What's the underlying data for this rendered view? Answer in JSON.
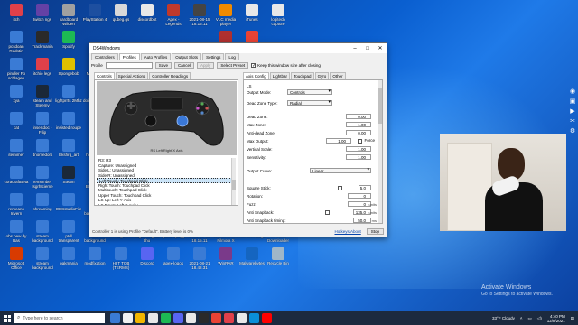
{
  "desktop": {
    "icons": [
      {
        "label": "itch",
        "color": "#e0404a",
        "col": 0,
        "row": 0
      },
      {
        "label": "twitch ngs",
        "color": "#6441a5",
        "col": 1,
        "row": 0
      },
      {
        "label": "cardboard Wilden",
        "color": "#a0a0a0",
        "col": 2,
        "row": 0
      },
      {
        "label": "PlayStation 4",
        "color": "#1d4fa0",
        "col": 3,
        "row": 0
      },
      {
        "label": "qubeg.gs",
        "color": "#d8d8d8",
        "col": 4,
        "row": 0
      },
      {
        "label": "discordbot",
        "color": "#e8e8e8",
        "col": 5,
        "row": 0
      },
      {
        "label": "Apex - Legends",
        "color": "#c0392b",
        "col": 6,
        "row": 0
      },
      {
        "label": "2021-08-15 18.15.11",
        "color": "#444",
        "col": 7,
        "row": 0
      },
      {
        "label": "VLC media player",
        "color": "#f08a00",
        "col": 8,
        "row": 0
      },
      {
        "label": "iTunes",
        "color": "#e8e8e8",
        "col": 9,
        "row": 0
      },
      {
        "label": "logitech capture",
        "color": "#e8e8e8",
        "col": 10,
        "row": 0
      },
      {
        "label": "pcsdoan Redstin",
        "color": "#3a7bd5",
        "col": 0,
        "row": 1
      },
      {
        "label": "Trackmania",
        "color": "#2a2a2a",
        "col": 1,
        "row": 1
      },
      {
        "label": "Spotify",
        "color": "#1db954",
        "col": 2,
        "row": 1
      },
      {
        "label": "Ghostwire",
        "color": "#b03030",
        "col": 8,
        "row": 1
      },
      {
        "label": "Google",
        "color": "#ea4335",
        "col": 9,
        "row": 1
      },
      {
        "label": "pindler Fo schlagen",
        "color": "#3a7bd5",
        "col": 0,
        "row": 2
      },
      {
        "label": "itchio legs",
        "color": "#e0404a",
        "col": 1,
        "row": 2
      },
      {
        "label": "Spongebob",
        "color": "#e0c000",
        "col": 2,
        "row": 2
      },
      {
        "label": "Minecraft",
        "color": "#5a8a2a",
        "col": 3,
        "row": 2
      },
      {
        "label": "xya",
        "color": "#3a7bd5",
        "col": 0,
        "row": 3
      },
      {
        "label": "steam and Steemy",
        "color": "#1b2838",
        "col": 1,
        "row": 3
      },
      {
        "label": "lightprrts 2Mhz",
        "color": "#3a7bd5",
        "col": 2,
        "row": 3
      },
      {
        "label": "doi vicity te 2",
        "color": "#3a7bd5",
        "col": 3,
        "row": 3
      },
      {
        "label": "cat",
        "color": "#3a7bd5",
        "col": 0,
        "row": 4
      },
      {
        "label": "insertdoc - Filip",
        "color": "#3a7bd5",
        "col": 1,
        "row": 4
      },
      {
        "label": "insisted roupe",
        "color": "#3a7bd5",
        "col": 2,
        "row": 4
      },
      {
        "label": "mega",
        "color": "#3a7bd5",
        "col": 3,
        "row": 4
      },
      {
        "label": "itemimer",
        "color": "#3a7bd5",
        "col": 0,
        "row": 5
      },
      {
        "label": "dnomedors",
        "color": "#3a7bd5",
        "col": 1,
        "row": 5
      },
      {
        "label": "Ekshrg_art",
        "color": "#3a7bd5",
        "col": 2,
        "row": 5
      },
      {
        "label": "hime Orin",
        "color": "#3a7bd5",
        "col": 3,
        "row": 5
      },
      {
        "label": "coracraftBeta",
        "color": "#3a7bd5",
        "col": 0,
        "row": 6
      },
      {
        "label": "remember Isgrhtcieme",
        "color": "#3a7bd5",
        "col": 1,
        "row": 6
      },
      {
        "label": "Steam",
        "color": "#1b2838",
        "col": 2,
        "row": 6
      },
      {
        "label": "NVIDIA Broadcast",
        "color": "#76b900",
        "col": 3,
        "row": 6
      },
      {
        "label": "remeans Invern",
        "color": "#3a7bd5",
        "col": 0,
        "row": 7
      },
      {
        "label": "shreaming",
        "color": "#3a7bd5",
        "col": 1,
        "row": 7
      },
      {
        "label": "OBSstudioFile",
        "color": "#3a7bd5",
        "col": 2,
        "row": 7
      },
      {
        "label": "new background",
        "color": "#3a7bd5",
        "col": 3,
        "row": 7
      },
      {
        "label": "new background",
        "color": "#3a7bd5",
        "col": 6,
        "row": 7
      },
      {
        "label": "new background",
        "color": "#3a7bd5",
        "col": 7,
        "row": 7
      },
      {
        "label": "new background",
        "color": "#3a7bd5",
        "col": 8,
        "row": 7
      },
      {
        "label": "obs new dy Bas",
        "color": "#3a7bd5",
        "col": 0,
        "row": 8
      },
      {
        "label": "stream background",
        "color": "#3a7bd5",
        "col": 1,
        "row": 8
      },
      {
        "label": "pIdl transparent",
        "color": "#3a7bd5",
        "col": 2,
        "row": 8
      },
      {
        "label": "new background",
        "color": "#3a7bd5",
        "col": 3,
        "row": 8
      },
      {
        "label": "logo",
        "color": "#3a7bd5",
        "col": 4,
        "row": 8
      },
      {
        "label": "ntgdix svg as thu",
        "color": "#3a7bd5",
        "col": 5,
        "row": 8
      },
      {
        "label": "game sprigg",
        "color": "#3a7bd5",
        "col": 6,
        "row": 8
      },
      {
        "label": "2021-08-15 18.15.11",
        "color": "#3a7bd5",
        "col": 7,
        "row": 8
      },
      {
        "label": "Wondershare Filmora X",
        "color": "#3a7bd5",
        "col": 8,
        "row": 8
      },
      {
        "label": "Microsoft Edge",
        "color": "#0a8fd8",
        "col": 9,
        "row": 8
      },
      {
        "label": "4K Video Downloader",
        "color": "#2a2a2a",
        "col": 10,
        "row": 8
      },
      {
        "label": "Microsoft Office",
        "color": "#d83b01",
        "col": 0,
        "row": 9
      },
      {
        "label": "stream background",
        "color": "#3a7bd5",
        "col": 1,
        "row": 9
      },
      {
        "label": "pakmania",
        "color": "#3a7bd5",
        "col": 2,
        "row": 9
      },
      {
        "label": "modfixation",
        "color": "#3a7bd5",
        "col": 3,
        "row": 9
      },
      {
        "label": "HIIT TOB (TERMS)",
        "color": "#3a7bd5",
        "col": 4,
        "row": 9
      },
      {
        "label": "Discord",
        "color": "#5865f2",
        "col": 5,
        "row": 9
      },
      {
        "label": "apex-logos",
        "color": "#3a7bd5",
        "col": 6,
        "row": 9
      },
      {
        "label": "2021-08-21 18.48.31",
        "color": "#3a7bd5",
        "col": 7,
        "row": 9
      },
      {
        "label": "WinRAR",
        "color": "#7a3a8a",
        "col": 8,
        "row": 9
      },
      {
        "label": "Malwarebytes",
        "color": "#1565c0",
        "col": 9,
        "row": 9
      },
      {
        "label": "Recycle Bin",
        "color": "#9fb6c8",
        "col": 10,
        "row": 9
      }
    ]
  },
  "window": {
    "title": "DS4Windows",
    "tabs": [
      "Controllers",
      "Profiles",
      "Auto Profiles",
      "Output Slots",
      "Settings",
      "Log"
    ],
    "active_tab": 1,
    "profile_label": "Profile",
    "profile_value": "",
    "buttons": {
      "save": "Save",
      "cancel": "Cancel",
      "apply": "Apply",
      "select_preset": "Select Preset"
    },
    "keep_size_label": "Keep this window size after closing",
    "left_tabs": [
      "Controls",
      "Special Actions",
      "Controller Readings"
    ],
    "controller_caption": "RS Left Right X Axis",
    "binding_list": [
      "R3: R3",
      "Capture: Unassigned",
      "Side L: Unassigned",
      "Side R: Unassigned",
      "Left Touch: Touchpad Click",
      "Right Touch: Touchpad Click",
      "Multitouch: Touchpad Click",
      "Upper Touch: Touchpad Click",
      "LS Up: Left Y-Axis-",
      "LS Down: Left Y-Axis+"
    ],
    "selected_binding": 4,
    "right_tabs": [
      "Axis Config",
      "Lightbar",
      "Touchpad",
      "Gyro",
      "Other"
    ],
    "settings": {
      "section": "LS",
      "output_mode_label": "Output Mode:",
      "output_mode_value": "Controls",
      "dead_zone_type_label": "Dead Zone Type:",
      "dead_zone_type_value": "Radial",
      "rows": [
        {
          "label": "Dead Zone:",
          "value": "0.00"
        },
        {
          "label": "Max Zone:",
          "value": "1.00"
        },
        {
          "label": "Anti-dead Zone:",
          "value": "0.00"
        },
        {
          "label": "Max Output:",
          "value": "1.00"
        },
        {
          "label": "Vertical Scale:",
          "value": "1.00"
        },
        {
          "label": "Sensitivity:",
          "value": "1.00"
        }
      ],
      "force_label": "Force",
      "output_curve_label": "Output Curve:",
      "output_curve_value": "Linear",
      "square_stick_label": "Square Stick:",
      "square_stick_value": "5.0",
      "rotation_label": "Rotation:",
      "rotation_value": "0",
      "fuzz_label": "Fuzz:",
      "fuzz_value": "0",
      "fuzz_unit": "units",
      "anti_snapback_label": "Anti Snapback:",
      "anti_snapback_value": "135.0",
      "anti_snapback_unit": "units",
      "anti_snapback_timing_label": "Anti Snapback timing:",
      "anti_snapback_timing_value": "50.0",
      "anti_snapback_timing_unit": "ms"
    },
    "status_message": "Controller 1 is using Profile \"Default\". Battery level is 0%",
    "hotkeys_link": "Hotkeys/About",
    "stop_button": "Stop"
  },
  "activate": {
    "line1": "Activate Windows",
    "line2": "Go to Settings to activate Windows."
  },
  "taskbar": {
    "search_placeholder": "Type here to search",
    "icons": [
      "#3a7bd5",
      "#f0f0f0",
      "#f2b600",
      "#e8e8e8",
      "#1db954",
      "#5865f2",
      "#e8e8e8",
      "#2a2a2a",
      "#ea4335",
      "#e0404a",
      "#e8e8e8",
      "#0a8fd8",
      "#ff0000"
    ],
    "weather": "33°F  Cloudy",
    "time": "4:40 PM",
    "date": "12/8/2021"
  }
}
